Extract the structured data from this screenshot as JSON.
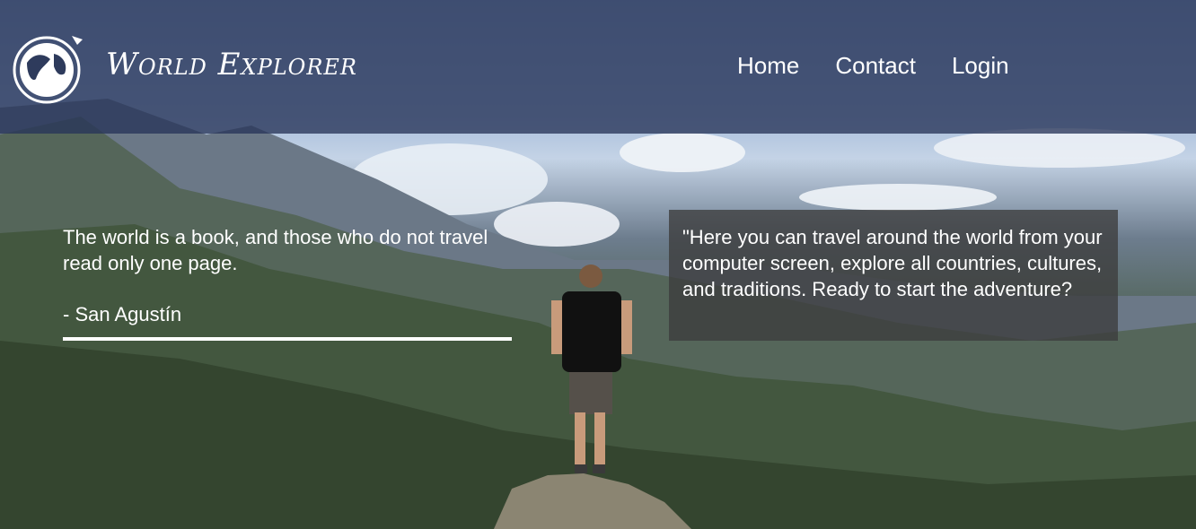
{
  "brand": {
    "name": "World Explorer",
    "logo_icon": "globe-icon"
  },
  "nav": {
    "home": "Home",
    "contact": "Contact",
    "login": "Login"
  },
  "quote": {
    "text": "The world is a book, and those who do not travel read only one page.",
    "author": "- San Agustín"
  },
  "intro": {
    "text": "\"Here you can travel around the world from your computer screen, explore all countries, cultures, and traditions. Ready to start the adventure?"
  },
  "colors": {
    "header_overlay": "#283458",
    "intro_box": "#3c3c3c",
    "text": "#ffffff"
  }
}
